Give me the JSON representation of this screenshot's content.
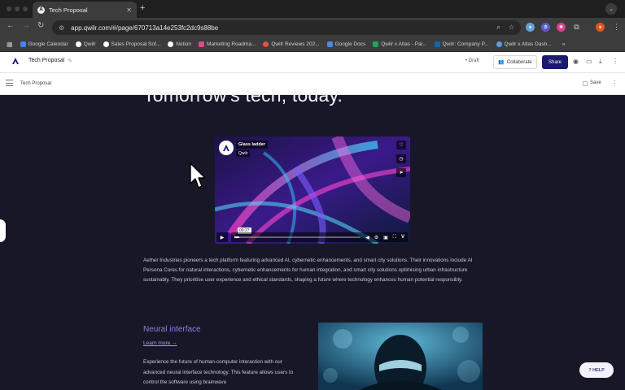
{
  "browser": {
    "tab_title": "Tech Proposal",
    "tab_favicon": "A",
    "url": "app.qwilr.com/#/page/670713a14e253fc2dc9s88be",
    "bookmarks": [
      {
        "label": "Google Calendar",
        "color": "#4285f4"
      },
      {
        "label": "Qwilr",
        "color": "#ffffff"
      },
      {
        "label": "Sales Proposal Sof...",
        "color": "#ffffff"
      },
      {
        "label": "Notion",
        "color": "#ffffff"
      },
      {
        "label": "Marketing Roadma...",
        "color": "#e04a8a"
      },
      {
        "label": "Qwilr Reviews 202...",
        "color": "#e5533d"
      },
      {
        "label": "Google Docs",
        "color": "#4f86ec"
      },
      {
        "label": "Qwilr x Atlas - Pai...",
        "color": "#21a366"
      },
      {
        "label": "Qwilr: Company P...",
        "color": "#0a66c2"
      },
      {
        "label": "Qwilr x Atlas Dash...",
        "color": "#5aa0e0"
      }
    ]
  },
  "app": {
    "doc_title": "Tech Proposal",
    "status": "Draft",
    "collaborate_label": "Collaborate",
    "share_label": "Share",
    "sub_title": "Tech Proposal",
    "save_label": "Save"
  },
  "page": {
    "hero": "Tomorrow's tech, today.",
    "video": {
      "title": "Glass ladder",
      "channel": "Qwilr",
      "time": "00:27",
      "progress": 0.04
    },
    "paragraph": "Aether Industries pioneers a tech platform featuring advanced AI, cybernetic enhancements, and smart city solutions. Their innovations include AI Persona Cores for natural interactions, cybernetic enhancements for human integration, and smart city solutions optimising urban infrastructure sustainably. They prioritise user experience and ethical standards, shaping a future where technology enhances human potential responsibly.",
    "section_title": "Neural interface",
    "learn_more": "Learn more →",
    "section_body": "Experience the future of human-computer interaction with our advanced neural interface technology. This feature allows users to control the software using brainwave"
  },
  "help_label": "? HELP",
  "colors": {
    "canvas_bg": "#181728",
    "accent": "#1b1a6b",
    "section_title": "#8a7fe0"
  }
}
